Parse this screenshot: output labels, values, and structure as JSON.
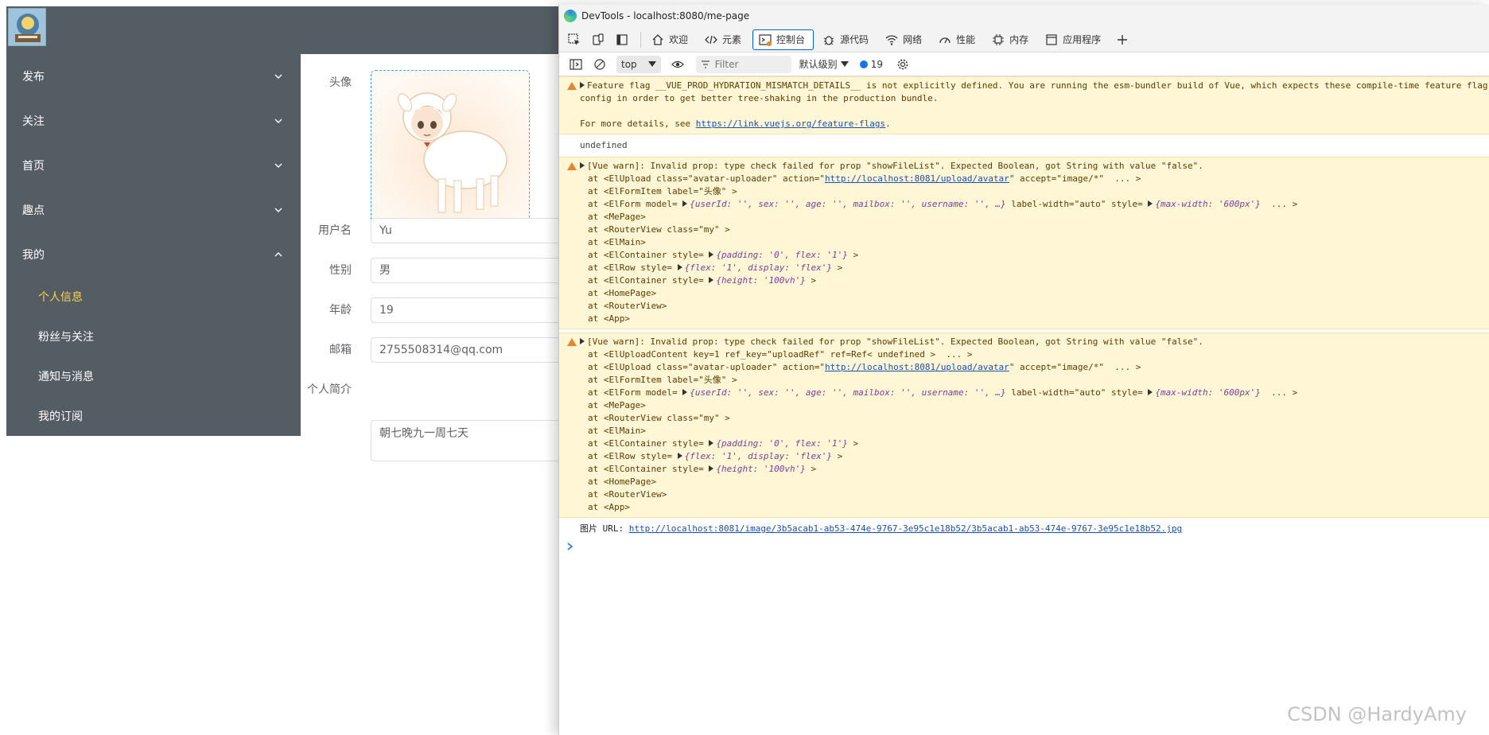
{
  "sidebar": {
    "menus": [
      {
        "label": "发布",
        "expanded": false
      },
      {
        "label": "关注",
        "expanded": false
      },
      {
        "label": "首页",
        "expanded": false
      },
      {
        "label": "趣点",
        "expanded": false
      },
      {
        "label": "我的",
        "expanded": true
      }
    ],
    "submenu": [
      {
        "label": "个人信息",
        "active": true
      },
      {
        "label": "粉丝与关注",
        "active": false
      },
      {
        "label": "通知与消息",
        "active": false
      },
      {
        "label": "我的订阅",
        "active": false
      }
    ],
    "active_color": "#ffd04b",
    "bg_color": "#545c64"
  },
  "form": {
    "avatar_label": "头像",
    "username_label": "用户名",
    "username_value": "Yu",
    "sex_label": "性别",
    "sex_value": "男",
    "age_label": "年龄",
    "age_value": "19",
    "mail_label": "邮箱",
    "mail_value": "2755508314@qq.com",
    "bio_label": "个人简介",
    "bio_value": "朝七晚九一周七天"
  },
  "devtools": {
    "title": "DevTools - localhost:8080/me-page",
    "tabs": [
      {
        "label": "欢迎",
        "icon": "home-icon",
        "active": false
      },
      {
        "label": "元素",
        "icon": "code-icon",
        "active": false
      },
      {
        "label": "控制台",
        "icon": "console-icon",
        "active": true
      },
      {
        "label": "源代码",
        "icon": "bug-icon",
        "active": false
      },
      {
        "label": "网络",
        "icon": "wifi-icon",
        "active": false
      },
      {
        "label": "性能",
        "icon": "gauge-icon",
        "active": false
      },
      {
        "label": "内存",
        "icon": "chip-icon",
        "active": false
      },
      {
        "label": "应用程序",
        "icon": "app-icon",
        "active": false
      }
    ],
    "toolbar": {
      "context": "top",
      "filter_placeholder": "Filter",
      "level": "默认级别",
      "issues_count": "19"
    },
    "console": {
      "msg1": {
        "l1": "Feature flag __VUE_PROD_HYDRATION_MISMATCH_DETAILS__ is not explicitly defined. You are running the esm-bundler build of Vue, which expects these compile-time feature flag",
        "l2": "config in order to get better tree-shaking in the production bundle.",
        "l3_prefix": "For more details, see ",
        "l3_link": "https://link.vuejs.org/feature-flags",
        "l3_suffix": "."
      },
      "undefined_text": "undefined",
      "msg2": {
        "head": "[Vue warn]: Invalid prop: type check failed for prop \"showFileList\". Expected Boolean, got String with value \"false\".",
        "upload_prefix": "at <ElUpload class=\"avatar-uploader\" action=\"",
        "upload_link": "http://localhost:8081/upload/avatar",
        "upload_suffix": "\" accept=\"image/*\"  ... >",
        "formitem": "at <ElFormItem label=\"头像\" >",
        "form_prefix": "at <ElForm model= ",
        "form_obj": "{userId: '', sex: '', age: '', mailbox: '', username: '', …}",
        "form_mid": " label-width=\"auto\" style= ",
        "form_obj2": "{max-width: '600px'}",
        "form_suffix": "  ... >",
        "mepage": "at <MePage>",
        "router_my": "at <RouterView class=\"my\" >",
        "elmain": "at <ElMain>",
        "cont1_prefix": "at <ElContainer style= ",
        "cont1_obj": "{padding: '0', flex: '1'}",
        "row_prefix": "at <ElRow style= ",
        "row_obj": "{flex: '1', display: 'flex'}",
        "cont2_prefix": "at <ElContainer style= ",
        "cont2_obj": "{height: '100vh'}",
        "homepage": "at <HomePage>",
        "router": "at <RouterView>",
        "app": "at <App>",
        "close": " >"
      },
      "msg3": {
        "head": "[Vue warn]: Invalid prop: type check failed for prop \"showFileList\". Expected Boolean, got String with value \"false\".",
        "content": "at <ElUploadContent key=1 ref_key=\"uploadRef\" ref=Ref< undefined >  ... >"
      },
      "log_prefix": "图片 URL: ",
      "log_link": "http://localhost:8081/image/3b5acab1-ab53-474e-9767-3e95c1e18b52/3b5acab1-ab53-474e-9767-3e95c1e18b52.jpg"
    }
  },
  "watermark": "CSDN @HardyAmy"
}
